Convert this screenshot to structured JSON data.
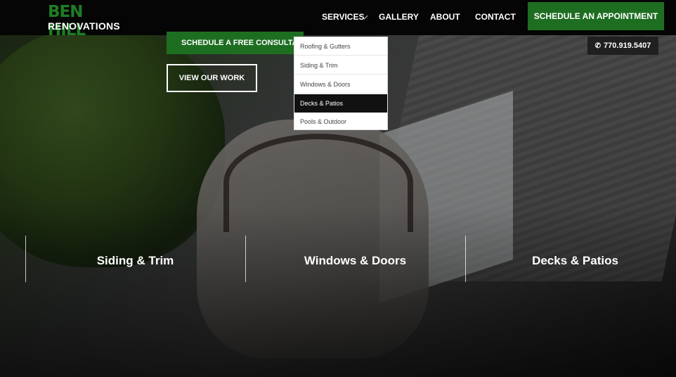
{
  "header": {
    "logo": {
      "line1": "BEN HILL",
      "line2": "RENOVATIONS"
    },
    "nav": {
      "services": "SERVICES",
      "gallery": "GALLERY",
      "about": "ABOUT",
      "contact": "CONTACT"
    },
    "cta": "SCHEDULE AN APPOINTMENT"
  },
  "hero": {
    "consult_button": "SCHEDULE A FREE CONSULTATI",
    "work_button": "VIEW OUR WORK",
    "phone": "770.919.5407"
  },
  "services_menu": {
    "items": [
      {
        "label": "Roofing & Gutters"
      },
      {
        "label": "Siding & Trim"
      },
      {
        "label": "Windows & Doors"
      },
      {
        "label": "Decks & Patios"
      },
      {
        "label": "Pools & Outdoor"
      }
    ],
    "highlighted": "Decks & Patios"
  },
  "service_panels": [
    {
      "label": "Siding & Trim"
    },
    {
      "label": "Windows & Doors"
    },
    {
      "label": "Decks & Patios"
    }
  ],
  "colors": {
    "brand_green": "#1e6e22",
    "logo_green": "#1e7d24",
    "header_bg": "#050505"
  },
  "icons": {
    "phone": "phone-icon",
    "services_caret": "chevron-down-icon"
  }
}
